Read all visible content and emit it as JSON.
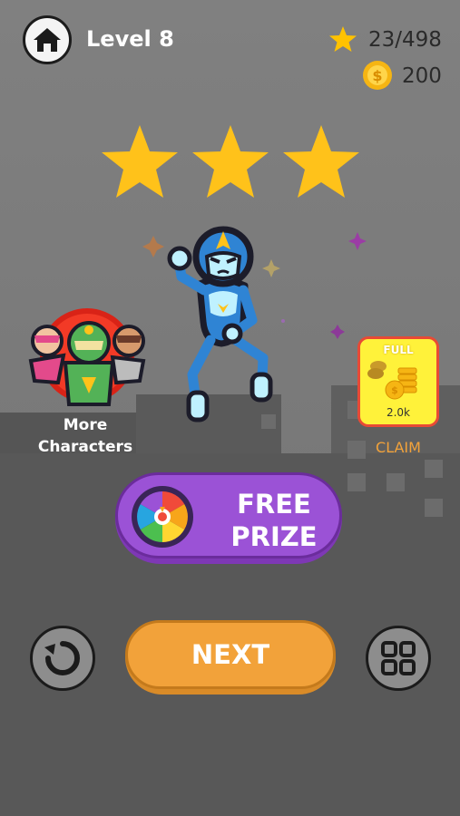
{
  "header": {
    "level_label": "Level 8",
    "stars_count": "23/498",
    "coins_count": "200"
  },
  "rating": {
    "stars_earned": 3,
    "stars_total": 3
  },
  "more_characters": {
    "label_line1": "More",
    "label_line2": "Characters"
  },
  "coin_bank": {
    "status": "FULL",
    "amount": "2.0k",
    "claim_label": "CLAIM"
  },
  "prize": {
    "line1": "FREE",
    "line2": "PRIZE"
  },
  "next_label": "NEXT",
  "colors": {
    "gold": "#ffcb1a",
    "purple": "#9b52d6",
    "orange": "#f2a23a",
    "hero_blue": "#2f84d4",
    "hero_light": "#bff1ff"
  }
}
